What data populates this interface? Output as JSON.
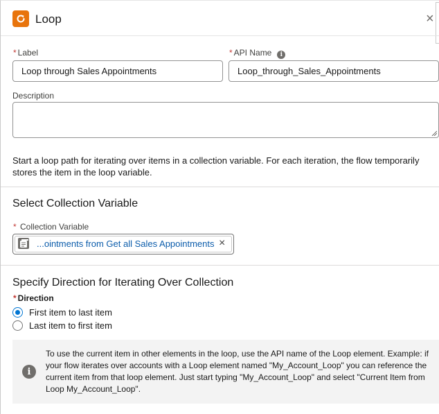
{
  "header": {
    "title": "Loop",
    "close_glyph": "×",
    "icon": "loop-icon",
    "icon_color": "#e8740c"
  },
  "fields": {
    "label": {
      "label": "Label",
      "value": "Loop through Sales Appointments"
    },
    "api_name": {
      "label": "API Name",
      "value": "Loop_through_Sales_Appointments"
    },
    "description": {
      "label": "Description",
      "value": ""
    }
  },
  "intro_text": "Start a loop path for iterating over items in a collection variable. For each iteration, the flow temporarily stores the item in the loop variable.",
  "collection": {
    "section_title": "Select Collection Variable",
    "field_label": "Collection Variable",
    "pill_value": "...ointments from Get all Sales Appointments",
    "pill_icon": "collection-icon",
    "remove_glyph": "×"
  },
  "direction": {
    "section_title": "Specify Direction for Iterating Over Collection",
    "field_label": "Direction",
    "options": [
      {
        "label": "First item to last item",
        "selected": true
      },
      {
        "label": "Last item to first item",
        "selected": false
      }
    ]
  },
  "note": {
    "text": "To use the current item in other elements in the loop, use the API name of the Loop element. Example: if your flow iterates over accounts with a Loop element named \"My_Account_Loop\" you can reference the current item from that loop element. Just start typing \"My_Account_Loop\" and select \"Current Item from Loop My_Account_Loop\"."
  },
  "colors": {
    "accent": "#0176d3",
    "required": "#c23934",
    "link": "#0b5cab"
  }
}
